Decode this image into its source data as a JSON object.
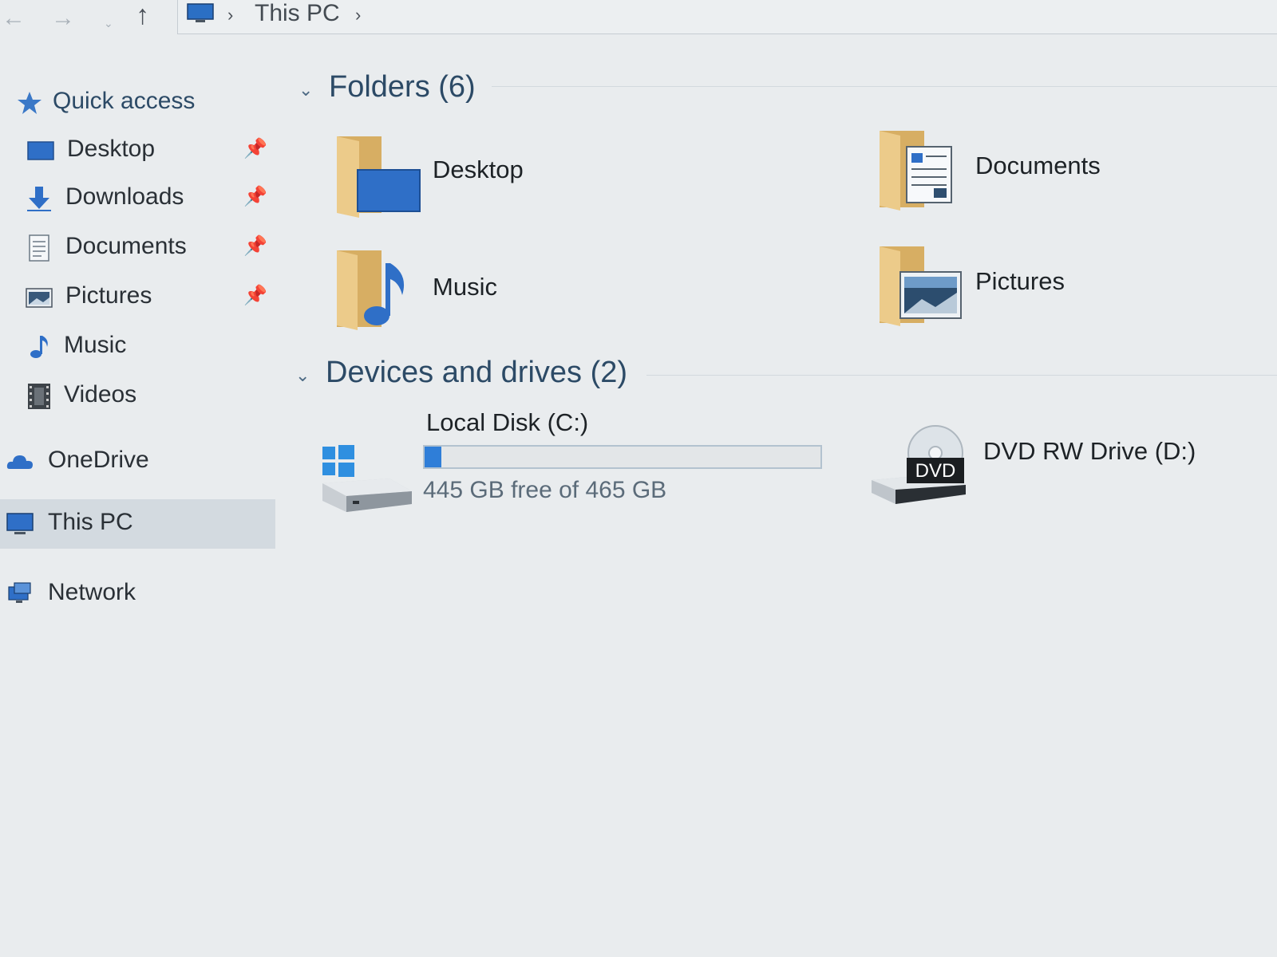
{
  "addressbar": {
    "path": [
      "This PC"
    ]
  },
  "sidebar": {
    "quick_access": "Quick access",
    "items": [
      {
        "label": "Desktop",
        "pinned": true
      },
      {
        "label": "Downloads",
        "pinned": true
      },
      {
        "label": "Documents",
        "pinned": true
      },
      {
        "label": "Pictures",
        "pinned": true
      },
      {
        "label": "Music",
        "pinned": false
      },
      {
        "label": "Videos",
        "pinned": false
      }
    ],
    "onedrive": "OneDrive",
    "this_pc": "This PC",
    "network": "Network"
  },
  "main": {
    "folders_header": "Folders (6)",
    "folders": [
      {
        "label": "Desktop"
      },
      {
        "label": "Documents"
      },
      {
        "label": "Music"
      },
      {
        "label": "Pictures"
      }
    ],
    "drives_header": "Devices and drives (2)",
    "drives": [
      {
        "label": "Local Disk (C:)",
        "free_text": "445 GB free of 465 GB",
        "used_fraction": 0.043
      },
      {
        "label": "DVD RW Drive (D:)",
        "badge": "DVD"
      }
    ]
  },
  "colors": {
    "accent": "#2f7ed8",
    "folder": "#d9b26a",
    "selection": "#d3dae0"
  }
}
